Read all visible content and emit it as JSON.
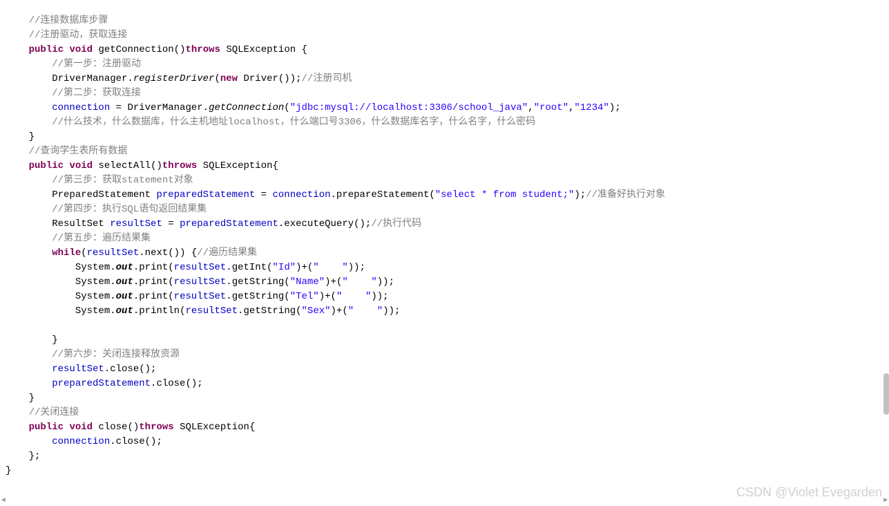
{
  "code": {
    "indent_unit": "    ",
    "comment1": "//连接数据库步骤",
    "comment2": "//注册驱动，获取连接",
    "kw_public": "public",
    "kw_void": "void",
    "kw_throws": "throws",
    "kw_new": "new",
    "kw_while": "while",
    "method_getConnection_name": "getConnection",
    "sqlexception": "SQLException",
    "line3_tail": "()",
    "line3_brace": " {",
    "comment_step1": "//第一步：注册驱动",
    "line5_driverManager": "DriverManager.",
    "line5_registerDriver": "registerDriver",
    "line5_open": "(",
    "line5_driver": " Driver());",
    "comment_register": "//注册司机",
    "comment_step2": "//第二步：获取连接",
    "line7_connection": "connection",
    "line7_assign": " = DriverManager.",
    "line7_getConnection": "getConnection",
    "line7_open": "(",
    "line7_str1": "\"jdbc:mysql://localhost:3306/school_java\"",
    "line7_comma1": ",",
    "line7_str2": "\"root\"",
    "line7_comma2": ",",
    "line7_str3": "\"1234\"",
    "line7_close": ");",
    "comment_tech": "//什么技术，什么数据库，什么主机地址localhost，什么端口号3306，什么数据库名字，什么名字，什么密码",
    "close_brace": "}",
    "comment_query": "//查询学生表所有数据",
    "method_selectAll": "selectAll",
    "selectAll_tail": "()",
    "selectAll_brace": "{",
    "comment_step3": "//第三步：获取statement对象",
    "line_ps_type": "PreparedStatement ",
    "line_ps_var": "preparedStatement",
    "line_ps_assign": " = ",
    "line_ps_conn": "connection",
    "line_ps_prepare": ".prepareStatement(",
    "line_ps_sql": "\"select * from student;\"",
    "line_ps_close": ");",
    "comment_ready": "//准备好执行对象",
    "comment_step4": "//第四步：执行SQL语句返回结果集",
    "line_rs_type": "ResultSet ",
    "line_rs_var": "resultSet",
    "line_rs_assign": " = ",
    "line_rs_ps": "preparedStatement",
    "line_rs_exec": ".executeQuery();",
    "comment_exec": "//执行代码",
    "comment_step5": "//第五步：遍历结果集",
    "while_open": "(",
    "while_rs": "resultSet",
    "while_next": ".next()) {",
    "comment_iterate": "//遍历结果集",
    "sys": "System.",
    "out": "out",
    "print": ".print(",
    "println": ".println(",
    "rs_getInt": ".getInt(",
    "rs_getString": ".getString(",
    "str_id": "\"Id\"",
    "str_name": "\"Name\"",
    "str_tel": "\"Tel\"",
    "str_sex": "\"Sex\"",
    "plus_open": ")+(",
    "str_spaces": "\"    \"",
    "end_paren": "));",
    "comment_step6": "//第六步：关闭连接释放资源",
    "rs_close_line_var": "resultSet",
    "close_call": ".close();",
    "ps_close_line_var": "preparedStatement",
    "comment_closeconn": "//关闭连接",
    "method_close_name": "close",
    "close_tail": "()",
    "close_brace_open": "{",
    "conn_close_var": "connection",
    "final_brace": "};"
  },
  "watermark": "CSDN @Violet Evegarden",
  "arrows": {
    "left": "◄",
    "right": "►"
  }
}
